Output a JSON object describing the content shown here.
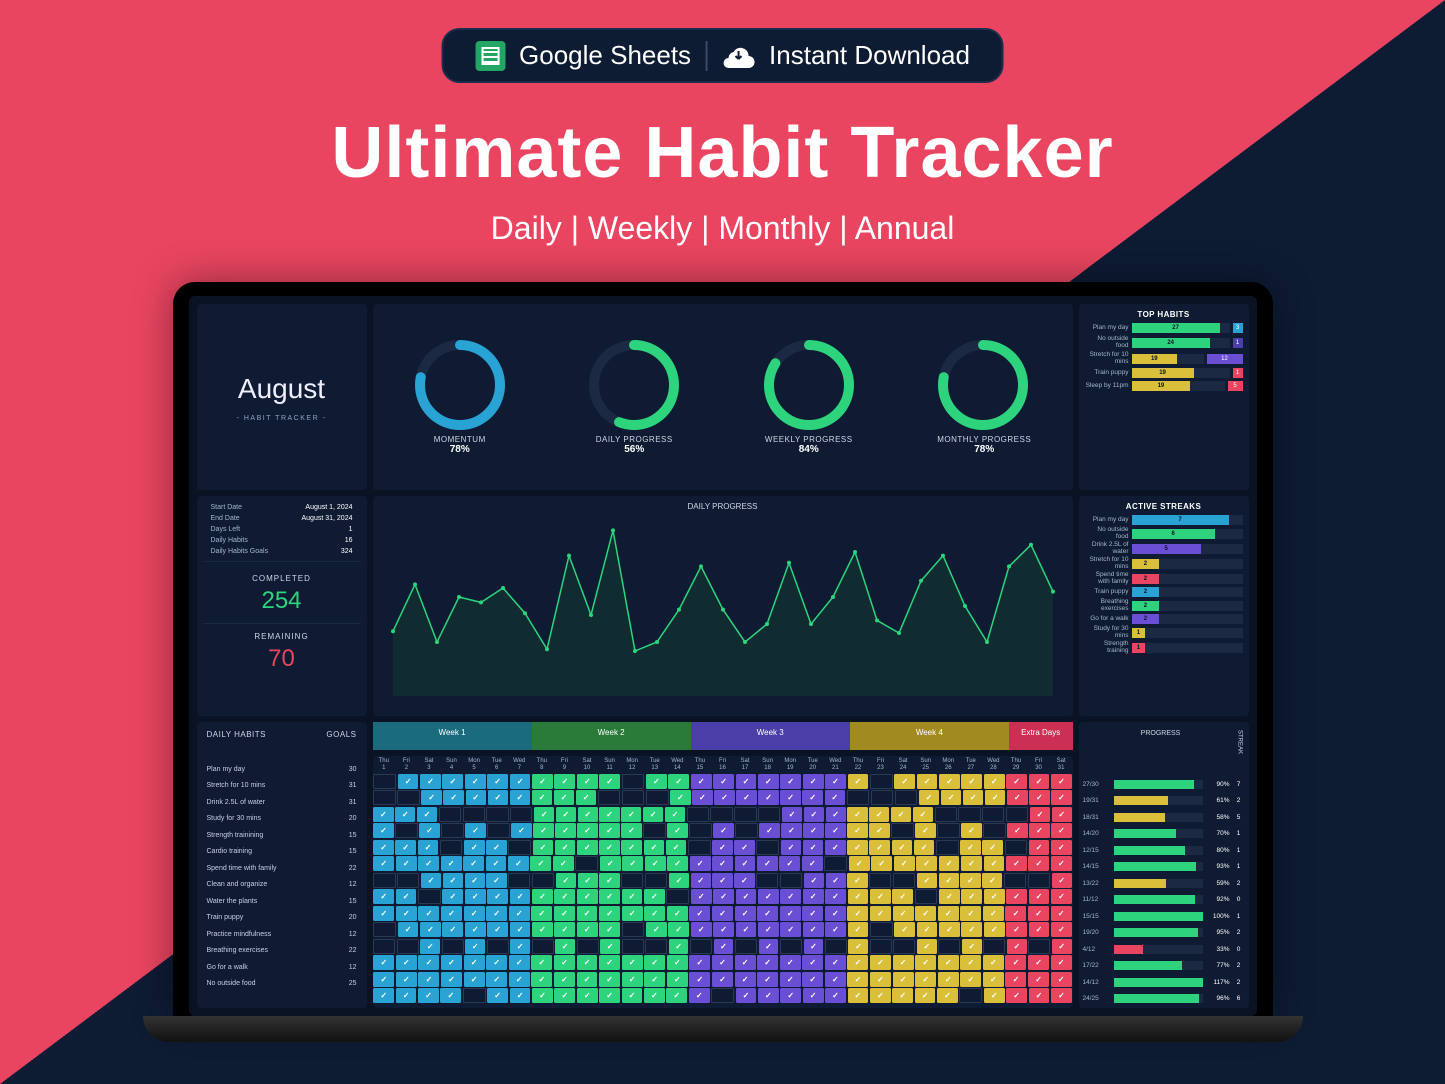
{
  "pill": {
    "sheets": "Google Sheets",
    "download": "Instant Download"
  },
  "hero": {
    "title": "Ultimate Habit Tracker",
    "sub": "Daily | Weekly | Monthly | Annual"
  },
  "month": {
    "name": "August",
    "sub": "- HABIT TRACKER -"
  },
  "rings": [
    {
      "label": "MOMENTUM",
      "pct": 78,
      "color": "#29a3d4"
    },
    {
      "label": "DAILY PROGRESS",
      "pct": 56,
      "color": "#2dd47d"
    },
    {
      "label": "WEEKLY PROGRESS",
      "pct": 84,
      "color": "#2dd47d"
    },
    {
      "label": "MONTHLY PROGRESS",
      "pct": 78,
      "color": "#2dd47d"
    }
  ],
  "info": {
    "rows": [
      {
        "k": "Start Date",
        "v": "August 1, 2024"
      },
      {
        "k": "End Date",
        "v": "August 31, 2024"
      },
      {
        "k": "Days Left",
        "v": "1"
      },
      {
        "k": "Daily Habits",
        "v": "16"
      },
      {
        "k": "Daily Habits Goals",
        "v": "324"
      }
    ],
    "completed_label": "COMPLETED",
    "completed": "254",
    "remaining_label": "REMAINING",
    "remaining": "70"
  },
  "topHabits": {
    "title": "TOP HABITS",
    "rows": [
      {
        "label": "Plan my day",
        "v": 27,
        "c": "#2dd47d",
        "ev": 3,
        "ec": "#29a3d4"
      },
      {
        "label": "No outside food",
        "v": 24,
        "c": "#2dd47d",
        "ev": 1,
        "ec": "#4a3ea8"
      },
      {
        "label": "Stretch for 10 mins",
        "v": 19,
        "c": "#d9bf3a",
        "ev": 12,
        "ec": "#6a4fd4"
      },
      {
        "label": "Train puppy",
        "v": 19,
        "c": "#d9bf3a",
        "ev": 1,
        "ec": "#e94560"
      },
      {
        "label": "Sleep by 11pm",
        "v": 19,
        "c": "#d9bf3a",
        "ev": 5,
        "ec": "#e94560"
      }
    ]
  },
  "lineChart": {
    "title": "DAILY PROGRESS"
  },
  "streaks": {
    "title": "ACTIVE STREAKS",
    "rows": [
      {
        "label": "Plan my day",
        "v": 7,
        "c": "#29a3d4"
      },
      {
        "label": "No outside food",
        "v": 6,
        "c": "#2dd47d"
      },
      {
        "label": "Drink 2.5L of water",
        "v": 5,
        "c": "#6a4fd4"
      },
      {
        "label": "Stretch for 10 mins",
        "v": 2,
        "c": "#d9bf3a"
      },
      {
        "label": "Spend time with family",
        "v": 2,
        "c": "#e94560"
      },
      {
        "label": "Train puppy",
        "v": 2,
        "c": "#29a3d4"
      },
      {
        "label": "Breathing exercises",
        "v": 2,
        "c": "#2dd47d"
      },
      {
        "label": "Go for a walk",
        "v": 2,
        "c": "#6a4fd4"
      },
      {
        "label": "Study for 30 mins",
        "v": 1,
        "c": "#d9bf3a"
      },
      {
        "label": "Strength training",
        "v": 1,
        "c": "#e94560"
      }
    ]
  },
  "weeks": [
    "Week 1",
    "Week 2",
    "Week 3",
    "Week 4",
    "Extra Days"
  ],
  "days": {
    "names": [
      "Thu",
      "Fri",
      "Sat",
      "Sun",
      "Mon",
      "Tue",
      "Wed",
      "Thu",
      "Fri",
      "Sat",
      "Sun",
      "Mon",
      "Tue",
      "Wed",
      "Thu",
      "Fri",
      "Sat",
      "Sun",
      "Mon",
      "Tue",
      "Wed",
      "Thu",
      "Fri",
      "Sat",
      "Sun",
      "Mon",
      "Tue",
      "Wed",
      "Thu",
      "Fri",
      "Sat"
    ]
  },
  "habitsHeader": {
    "name": "DAILY HABITS",
    "goals": "GOALS"
  },
  "progHeader": {
    "title": "PROGRESS",
    "streak": "STREAK"
  },
  "habits": [
    {
      "name": "Plan my day",
      "goal": 30,
      "frac": "27/30",
      "pct": 90,
      "stk": 7,
      "seed": 7
    },
    {
      "name": "Stretch for 10 mins",
      "goal": 31,
      "frac": "19/31",
      "pct": 61,
      "stk": 2,
      "seed": 3
    },
    {
      "name": "Drink 2.5L of water",
      "goal": 31,
      "frac": "18/31",
      "pct": 58,
      "stk": 5,
      "seed": 5
    },
    {
      "name": "Study for 30 mins",
      "goal": 20,
      "frac": "14/20",
      "pct": 70,
      "stk": 1,
      "seed": 9
    },
    {
      "name": "Strength trainining",
      "goal": 15,
      "frac": "12/15",
      "pct": 80,
      "stk": 1,
      "seed": 11
    },
    {
      "name": "Cardio training",
      "goal": 15,
      "frac": "14/15",
      "pct": 93,
      "stk": 1,
      "seed": 13
    },
    {
      "name": "Spend time with family",
      "goal": 22,
      "frac": "13/22",
      "pct": 59,
      "stk": 2,
      "seed": 17
    },
    {
      "name": "Clean and organize",
      "goal": 12,
      "frac": "11/12",
      "pct": 92,
      "stk": 0,
      "seed": 19
    },
    {
      "name": "Water the plants",
      "goal": 15,
      "frac": "15/15",
      "pct": 100,
      "stk": 1,
      "seed": 23
    },
    {
      "name": "Train puppy",
      "goal": 20,
      "frac": "19/20",
      "pct": 95,
      "stk": 2,
      "seed": 29
    },
    {
      "name": "Practice mindfulness",
      "goal": 12,
      "frac": "4/12",
      "pct": 33,
      "stk": 0,
      "seed": 31
    },
    {
      "name": "Breathing exercises",
      "goal": 22,
      "frac": "17/22",
      "pct": 77,
      "stk": 2,
      "seed": 37
    },
    {
      "name": "Go for a walk",
      "goal": 12,
      "frac": "14/12",
      "pct": 117,
      "stk": 2,
      "seed": 41
    },
    {
      "name": "No outside food",
      "goal": 25,
      "frac": "24/25",
      "pct": 96,
      "stk": 6,
      "seed": 43
    }
  ],
  "weekColors": [
    "#29a3d4",
    "#2dd47d",
    "#6a4fd4",
    "#d9bf3a",
    "#e94560"
  ],
  "chart_data": {
    "type": "line",
    "title": "DAILY PROGRESS",
    "x": [
      1,
      2,
      3,
      4,
      5,
      6,
      7,
      8,
      9,
      10,
      11,
      12,
      13,
      14,
      15,
      16,
      17,
      18,
      19,
      20,
      21,
      22,
      23,
      24,
      25,
      26,
      27,
      28,
      29,
      30,
      31
    ],
    "values": [
      36,
      62,
      30,
      55,
      52,
      60,
      46,
      26,
      78,
      45,
      92,
      25,
      30,
      48,
      72,
      48,
      30,
      40,
      74,
      40,
      55,
      80,
      42,
      35,
      64,
      78,
      50,
      30,
      72,
      84,
      58
    ],
    "ylim": [
      0,
      100
    ]
  }
}
